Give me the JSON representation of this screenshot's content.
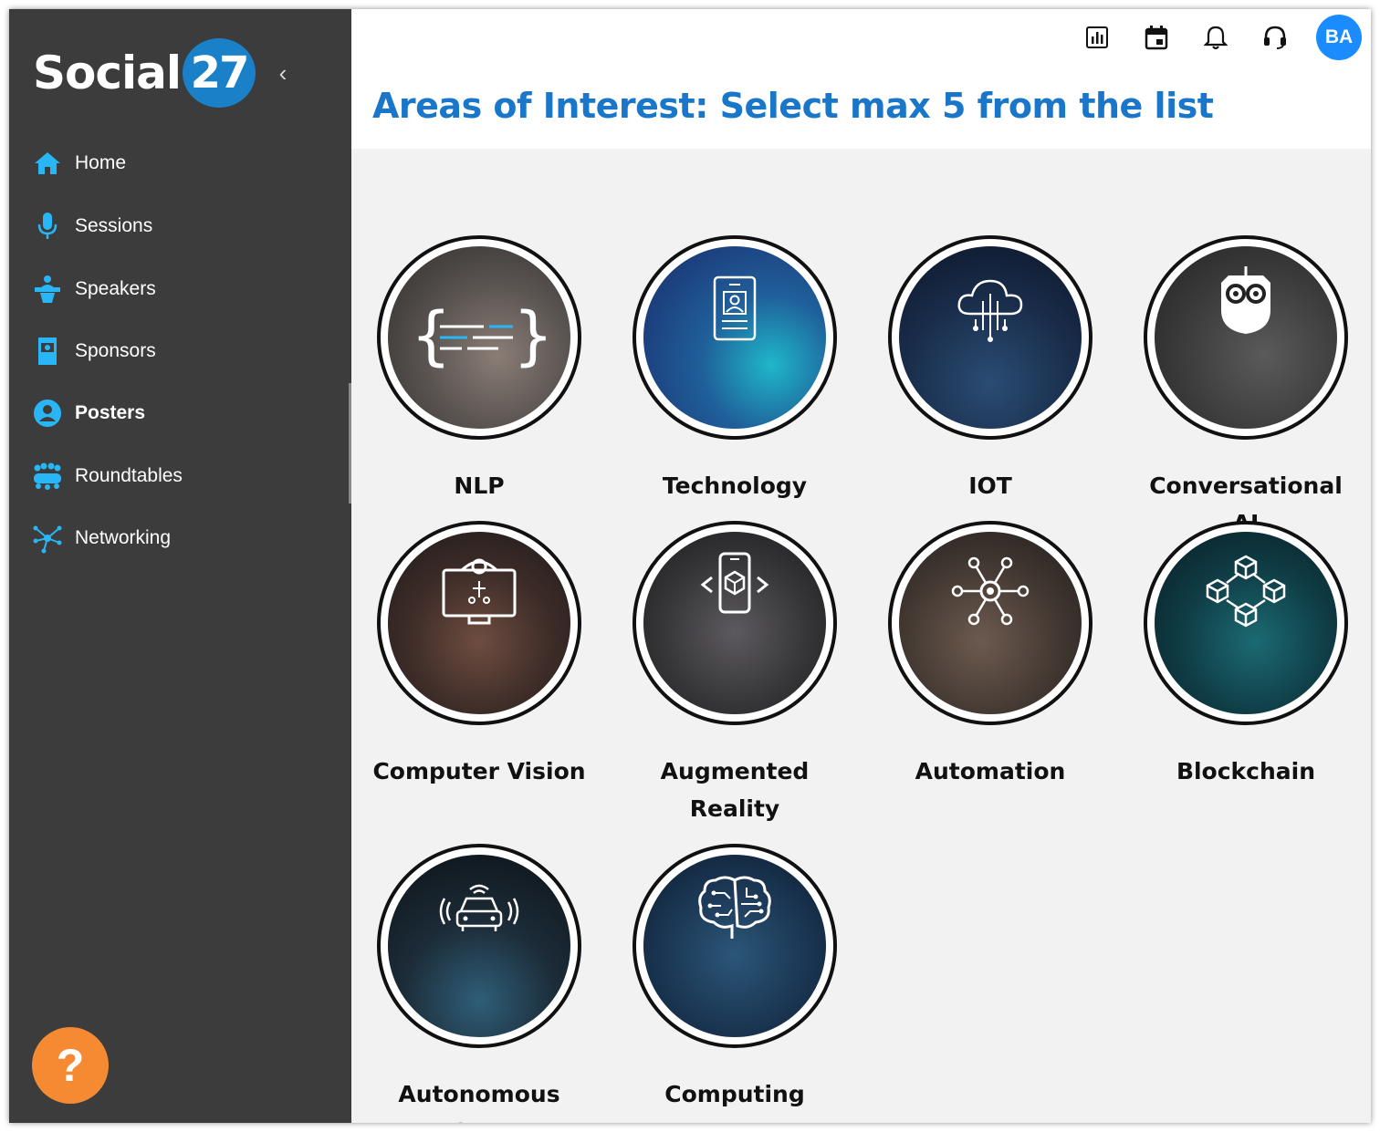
{
  "app": {
    "logo_text": "Social",
    "logo_badge": "27",
    "collapse_icon": "‹"
  },
  "sidebar": {
    "items": [
      {
        "label": "Home",
        "icon": "home-icon"
      },
      {
        "label": "Sessions",
        "icon": "microphone-icon"
      },
      {
        "label": "Speakers",
        "icon": "speaker-podium-icon"
      },
      {
        "label": "Sponsors",
        "icon": "booth-icon"
      },
      {
        "label": "Posters",
        "icon": "user-circle-icon",
        "active": true
      },
      {
        "label": "Roundtables",
        "icon": "group-table-icon"
      },
      {
        "label": "Networking",
        "icon": "network-icon"
      }
    ],
    "help_label": "?"
  },
  "header": {
    "icons": [
      "poll-icon",
      "calendar-icon",
      "bell-icon",
      "headset-icon"
    ],
    "avatar_initials": "BA",
    "title": "Areas of Interest: Select max 5 from the list"
  },
  "topics": [
    {
      "label": "NLP",
      "icon": "code-braces-icon"
    },
    {
      "label": "Technology",
      "icon": "id-card-icon"
    },
    {
      "label": "IOT",
      "icon": "cloud-circuit-icon"
    },
    {
      "label": "Conversational AI",
      "icon": "owl-bot-icon"
    },
    {
      "label": "Computer Vision",
      "icon": "monitor-eye-icon"
    },
    {
      "label": "Augmented Reality",
      "icon": "phone-cube-icon"
    },
    {
      "label": "Automation",
      "icon": "gear-nodes-icon"
    },
    {
      "label": "Blockchain",
      "icon": "linked-cubes-icon"
    },
    {
      "label": "Autonomous Cars",
      "icon": "car-signal-icon"
    },
    {
      "label": "Computing",
      "icon": "brain-circuit-icon"
    }
  ],
  "colors": {
    "accent": "#1976c8",
    "sidebar_bg": "#3c3c3c",
    "icon_cyan": "#29b6f6",
    "help_orange": "#f58a33",
    "avatar_blue": "#1a8cff"
  }
}
